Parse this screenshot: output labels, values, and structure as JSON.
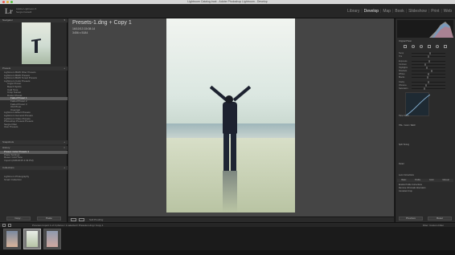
{
  "window": {
    "title": "Lightroom Catalog.lrcat - Adobe Photoshop Lightroom - Develop"
  },
  "identity": {
    "logo": "Lr",
    "line1": "Adobe Lightroom 6",
    "line2": "Sergio Fantelli"
  },
  "modules": [
    "Library",
    "Develop",
    "Map",
    "Book",
    "Slideshow",
    "Print",
    "Web"
  ],
  "active_module": "Develop",
  "left_panel": {
    "navigator_label": "Navigator",
    "presets_label": "Presets",
    "presets": [
      "Lightroom B&W Filter Presets",
      "Lightroom B&W Presets",
      "Lightroom B&W Toned Presets",
      "Lightroom Color Presets",
      "Lightroom Effect Presets",
      "Lightroom General Presets",
      "Lightroom Video Presets",
      "Photoshop Presets Presets",
      "Sergio Filter",
      "User Presets"
    ],
    "preset_children": [
      "Angie Preset",
      "Beach Spirits",
      "Cold Tone",
      "Crisp Sunset",
      "Duster Preset",
      "Faded Preset 1",
      "Faded Preset 2",
      "Faded Preset 3",
      "Old Photo",
      "Overcast"
    ],
    "selected_preset": "Faded Preset 1",
    "snapshots_label": "Snapshots",
    "history_label": "History",
    "history": [
      "Preset: Color Presets 1",
      "Paste Settings",
      "Reset: Cold Tone",
      "Import (2/26/2015 4:33 PM)"
    ],
    "collections_label": "Collections",
    "collections": [
      "Lightroom Photography",
      "Smart Collection"
    ],
    "copy_button": "Copy...",
    "paste_button": "Paste"
  },
  "photo": {
    "title": "Presets-1.dng + Copy 1",
    "date": "16/10/13 15:08:14",
    "dims": "3456 x 5184"
  },
  "toolbar": {
    "soft_proofing": "Soft Proofing"
  },
  "right_panel": {
    "histogram_label": "Histogram",
    "original_photo": "Original Photo",
    "sliders": [
      {
        "label": "Temp",
        "value": 0.55
      },
      {
        "label": "Tint",
        "value": 0.5
      },
      {
        "label": "Exposure",
        "value": 0.52
      },
      {
        "label": "Contrast",
        "value": 0.4
      },
      {
        "label": "Highlights",
        "value": 0.45
      },
      {
        "label": "Shadows",
        "value": 0.6
      },
      {
        "label": "Whites",
        "value": 0.5
      },
      {
        "label": "Blacks",
        "value": 0.48
      },
      {
        "label": "Clarity",
        "value": 0.5
      },
      {
        "label": "Vibrance",
        "value": 0.42
      },
      {
        "label": "Saturation",
        "value": 0.38
      }
    ],
    "tone_curve_label": "Tone Curve",
    "hsl_label": "HSL / Color / B&W",
    "split_toning_label": "Split Toning",
    "detail_label": "Detail",
    "lens_corrections_label": "Lens Corrections",
    "lens_tabs": [
      "Basic",
      "Profile",
      "Color",
      "Manual"
    ],
    "enable_profile": "Enable Profile Corrections",
    "remove_ca": "Remove Chromatic Aberration",
    "constrain_crop": "Constrain Crop",
    "previous_button": "Previous",
    "reset_button": "Reset"
  },
  "filmstrip": {
    "source": "Previous Import",
    "path": "1 of 3 photos / 1 selected / Presets-1.dng / Copy 1",
    "filter_label": "Filter:",
    "filter_value": "Custom Filter"
  }
}
